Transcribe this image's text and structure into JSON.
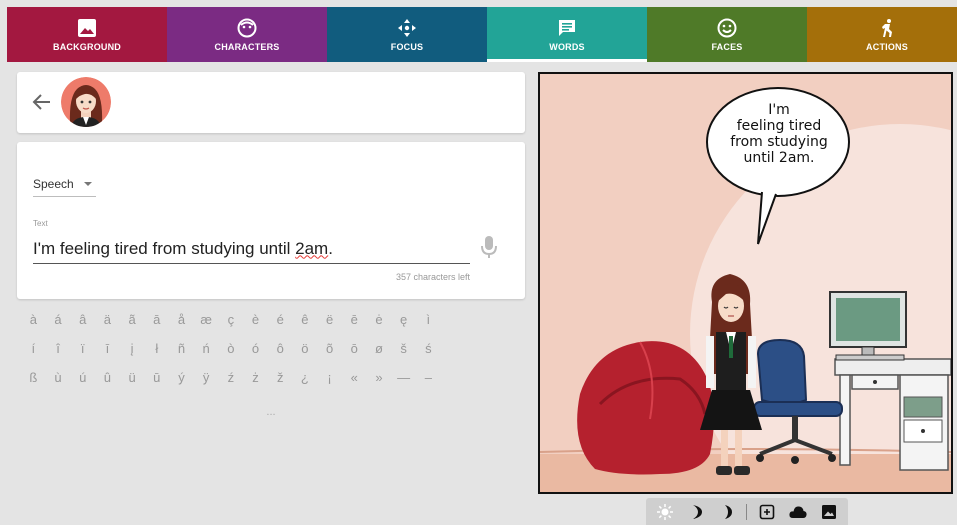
{
  "tabs": [
    {
      "label": "BACKGROUND",
      "color": "#a31840",
      "icon": "image-icon"
    },
    {
      "label": "CHARACTERS",
      "color": "#7b2b83",
      "icon": "face-outline-icon"
    },
    {
      "label": "FOCUS",
      "color": "#115c7e",
      "icon": "focus-arrows-icon"
    },
    {
      "label": "WORDS",
      "color": "#22a497",
      "icon": "speech-bubble-icon",
      "active": true
    },
    {
      "label": "FACES",
      "color": "#4f7a28",
      "icon": "smiley-icon"
    },
    {
      "label": "ACTIONS",
      "color": "#a46f0a",
      "icon": "running-person-icon"
    }
  ],
  "editor": {
    "speech_type": "Speech",
    "text_label": "Text",
    "text_before": "I'm feeling tired from studying until ",
    "text_misspelled": "2am",
    "text_after": ".",
    "chars_left": "357 characters left"
  },
  "special_chars": [
    [
      "à",
      "á",
      "â",
      "ä",
      "ã",
      "ā",
      "å",
      "æ",
      "ç",
      "è",
      "é",
      "ê",
      "ë",
      "ē",
      "ė",
      "ę",
      "ì"
    ],
    [
      "í",
      "î",
      "ï",
      "ī",
      "į",
      "ł",
      "ñ",
      "ń",
      "ò",
      "ó",
      "ô",
      "ö",
      "õ",
      "ō",
      "ø",
      "š",
      "ś"
    ],
    [
      "ß",
      "ù",
      "ú",
      "û",
      "ü",
      "ū",
      "ý",
      "ÿ",
      "ź",
      "ż",
      "ž",
      "¿",
      "¡",
      "«",
      "»",
      "—",
      "–"
    ]
  ],
  "more_chars": "...",
  "comic": {
    "bubble_line1": "I'm",
    "bubble_line2": "feeling tired",
    "bubble_line3": "from studying",
    "bubble_line4": "until 2am."
  },
  "toolbar_icons": [
    "sun-icon",
    "crescent-moon-icon",
    "thin-moon-icon",
    "add-photo-icon",
    "cloud-icon",
    "image-icon"
  ]
}
